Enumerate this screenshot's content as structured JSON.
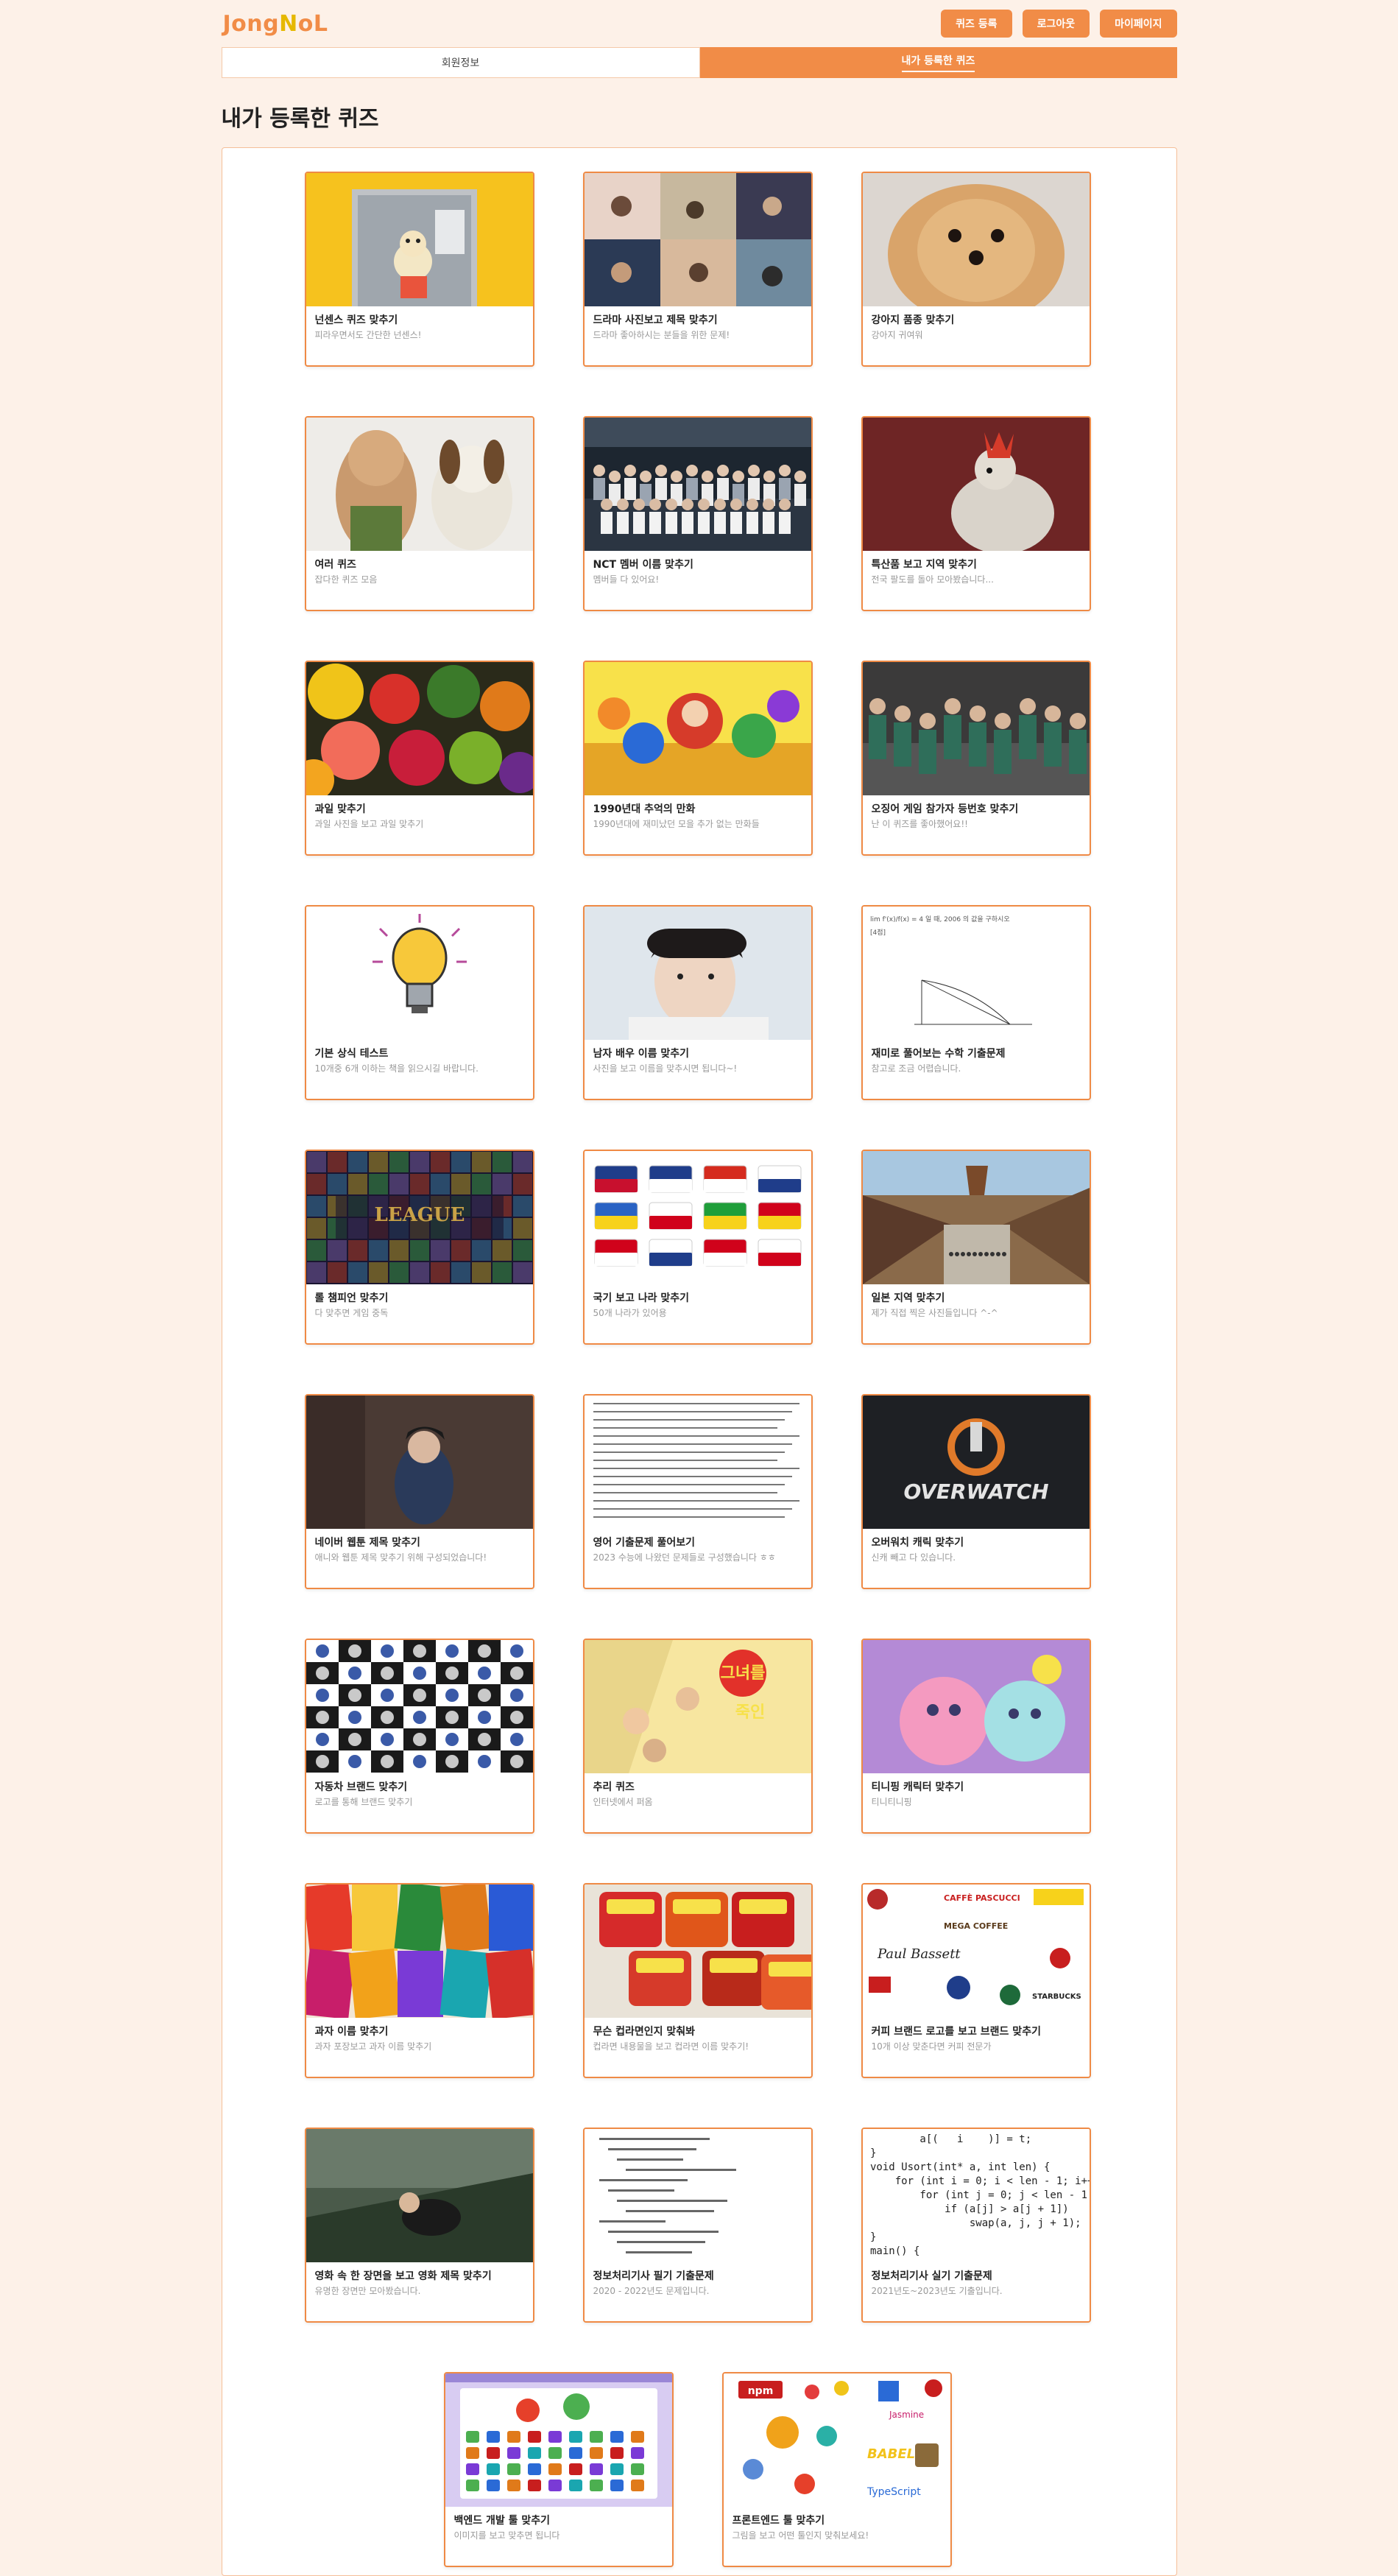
{
  "header": {
    "logo_letters": [
      {
        "char": "J",
        "color": "#f18c47"
      },
      {
        "char": "o",
        "color": "#f18c47"
      },
      {
        "char": "n",
        "color": "#f18c47"
      },
      {
        "char": "g",
        "color": "#f18c47"
      },
      {
        "char": "N",
        "color": "#e6b800"
      },
      {
        "char": "o",
        "color": "#f18c47"
      },
      {
        "char": "L",
        "color": "#f18c47"
      }
    ],
    "buttons": {
      "register": "퀴즈 등록",
      "logout": "로그아웃",
      "mypage": "마이페이지"
    }
  },
  "tabs": {
    "member_info": "회원정보",
    "my_quizzes": "내가 등록한 퀴즈"
  },
  "page_title": "내가 등록한 퀴즈",
  "colors": {
    "accent": "#f18c47",
    "background": "#fdf1e8"
  },
  "quizzes": [
    {
      "title": "넌센스 퀴즈 맞추기",
      "desc": "피라우면서도 간단한 넌센스!",
      "thumb": "cartoon-character-door"
    },
    {
      "title": "드라마 사진보고 제목 맞추기",
      "desc": "드라마 좋아하시는 분들을 위한 문제!",
      "thumb": "drama-posters"
    },
    {
      "title": "강아지 품종 맞추기",
      "desc": "강아지 귀여워",
      "thumb": "pomeranian-dog"
    },
    {
      "title": "여러 퀴즈",
      "desc": "잡다한 퀴즈 모음",
      "thumb": "clay-figures"
    },
    {
      "title": "NCT 멤버 이름 맞추기",
      "desc": "멤버들 다 있어요!",
      "thumb": "group-photo"
    },
    {
      "title": "특산품 보고 지역 맞추기",
      "desc": "전국 팔도를 돌아 모아봤습니다...",
      "thumb": "clay-chicken"
    },
    {
      "title": "과일 맞추기",
      "desc": "과일 사진을 보고 과일 맞추기",
      "thumb": "fruits"
    },
    {
      "title": "1990년대 추억의 만화",
      "desc": "1990년대에 재미났던 모을 추가 없는 만화들",
      "thumb": "cartoon-characters"
    },
    {
      "title": "오징어 게임 참가자 등번호 맞추기",
      "desc": "난 이 퀴즈를 좋아했어요!!",
      "thumb": "green-tracksuits"
    },
    {
      "title": "기본 상식 테스트",
      "desc": "10개중 6개 이하는 책을 읽으시길 바랍니다.",
      "thumb": "lightbulb"
    },
    {
      "title": "남자 배우 이름 맞추기",
      "desc": "사진을 보고 이름을 맞추시면 됩니다~!",
      "thumb": "actor-portrait"
    },
    {
      "title": "재미로 풀어보는 수학 기출문제",
      "desc": "참고로 조금 어렵습니다.",
      "thumb": "math-problem"
    },
    {
      "title": "롤 챔피언 맞추기",
      "desc": "다 맞추면 게임 중독",
      "thumb": "league-of-legends"
    },
    {
      "title": "국기 보고 나라 맞추기",
      "desc": "50개 나라가 있어용",
      "thumb": "flags"
    },
    {
      "title": "일본 지역 맞추기",
      "desc": "제가 직접 찍은 사진들입니다 ^-^",
      "thumb": "japan-street"
    },
    {
      "title": "네이버 웹툰 제목 맞추기",
      "desc": "애니와 웹툰 제목 맞추기 위해 구성되었습니다!",
      "thumb": "webtoon-character"
    },
    {
      "title": "영어 기출문제 풀어보기",
      "desc": "2023 수능에 나왔던 문제들로 구성했습니다 ㅎㅎ",
      "thumb": "english-text"
    },
    {
      "title": "오버워치 캐릭 맞추기",
      "desc": "신캐 빼고 다 있습니다.",
      "thumb": "overwatch-logo"
    },
    {
      "title": "자동차 브랜드 맞추기",
      "desc": "로고를 통해 브랜드 맞추기",
      "thumb": "car-logos"
    },
    {
      "title": "추리 퀴즈",
      "desc": "인터넷에서 퍼옴",
      "thumb": "detective-comic"
    },
    {
      "title": "티니핑 캐릭터 맞추기",
      "desc": "티니티니핑",
      "thumb": "tiniping"
    },
    {
      "title": "과자 이름 맞추기",
      "desc": "과자 포장보고 과자 이름 맞추기",
      "thumb": "snacks"
    },
    {
      "title": "무슨 컵라면인지 맞춰봐",
      "desc": "컵라면 내용물을 보고 컵라면 이름 맞추기!",
      "thumb": "cup-noodles"
    },
    {
      "title": "커피 브랜드 로고를 보고 브랜드 맞추기",
      "desc": "10개 이상 맞춘다면 커피 전문가",
      "thumb": "coffee-logos"
    },
    {
      "title": "영화 속 한 장면을 보고 영화 제목 맞추기",
      "desc": "유명한 장면만 모아봤습니다.",
      "thumb": "movie-scene"
    },
    {
      "title": "정보처리기사 필기 기출문제",
      "desc": "2020 - 2022년도 문제입니다.",
      "thumb": "java-code"
    },
    {
      "title": "정보처리기사 실기 기출문제",
      "desc": "2021년도~2023년도 기출입니다.",
      "thumb": "c-code"
    },
    {
      "title": "백엔드 개발 툴 맞추기",
      "desc": "이미지를 보고 맞추면 됩니다",
      "thumb": "backend-tools"
    },
    {
      "title": "프론트엔드 툴 맞추기",
      "desc": "그림을 보고 어떤 툴인지 맞춰보세요!",
      "thumb": "frontend-tools"
    }
  ]
}
